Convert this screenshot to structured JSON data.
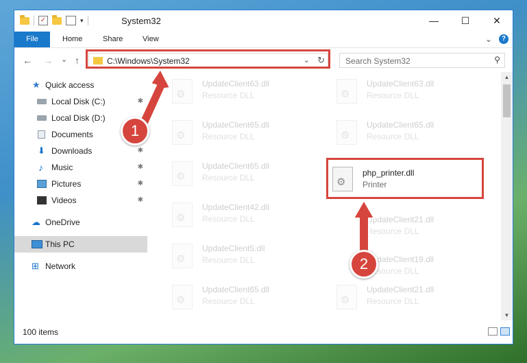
{
  "window": {
    "title": "System32",
    "minimize": "—",
    "maximize": "☐",
    "close": "✕"
  },
  "ribbon": {
    "tabs": [
      "File",
      "Home",
      "Share",
      "View"
    ],
    "expand_icon": "⌄",
    "help_label": "?"
  },
  "nav": {
    "back": "←",
    "forward": "→",
    "recent": "⌄",
    "up": "↑",
    "address": "C:\\Windows\\System32",
    "address_dropdown": "⌄",
    "refresh": "↻",
    "search_placeholder": "Search System32",
    "search_icon": "⚲"
  },
  "sidebar": {
    "items": [
      {
        "label": "Quick access",
        "icon": "star-icon",
        "pinned": false
      },
      {
        "label": "Local Disk (C:)",
        "icon": "drive-icon",
        "pinned": true
      },
      {
        "label": "Local Disk (D:)",
        "icon": "drive-icon",
        "pinned": false
      },
      {
        "label": "Documents",
        "icon": "documents-icon",
        "pinned": true
      },
      {
        "label": "Downloads",
        "icon": "download-icon",
        "pinned": true
      },
      {
        "label": "Music",
        "icon": "music-icon",
        "pinned": true
      },
      {
        "label": "Pictures",
        "icon": "pictures-icon",
        "pinned": true
      },
      {
        "label": "Videos",
        "icon": "videos-icon",
        "pinned": true
      },
      {
        "label": "OneDrive",
        "icon": "cloud-icon",
        "pinned": false
      },
      {
        "label": "This PC",
        "icon": "computer-icon",
        "pinned": false
      },
      {
        "label": "Network",
        "icon": "network-icon",
        "pinned": false
      }
    ],
    "pin_glyph": "📌"
  },
  "files": [
    {
      "name": "UpdateClient63.dll",
      "type": "Resource DLL"
    },
    {
      "name": "UpdateClient63.dll",
      "type": "Resource DLL"
    },
    {
      "name": "UpdateClient65.dll",
      "type": "Resource DLL"
    },
    {
      "name": "UpdateClient65.dll",
      "type": "Resource DLL"
    },
    {
      "name": "UpdateClient65.dll",
      "type": "Resource DLL"
    },
    {
      "name": "php_printer.dll",
      "type": "Printer"
    },
    {
      "name": "UpdateClient42.dll",
      "type": "Resource DLL"
    },
    {
      "name": "UpdateClient21.dll",
      "type": "Resource DLL"
    },
    {
      "name": "UpdateClient5.dll",
      "type": "Resource DLL"
    },
    {
      "name": "UpdateClient19.dll",
      "type": "Resource DLL"
    },
    {
      "name": "UpdateClient65.dll",
      "type": "Resource DLL"
    },
    {
      "name": "UpdateClient21.dll",
      "type": "Resource DLL"
    }
  ],
  "status": {
    "item_count": "100 items"
  },
  "callouts": [
    {
      "number": "1"
    },
    {
      "number": "2"
    }
  ],
  "colors": {
    "accent": "#1979ca",
    "highlight": "#d6453d"
  }
}
